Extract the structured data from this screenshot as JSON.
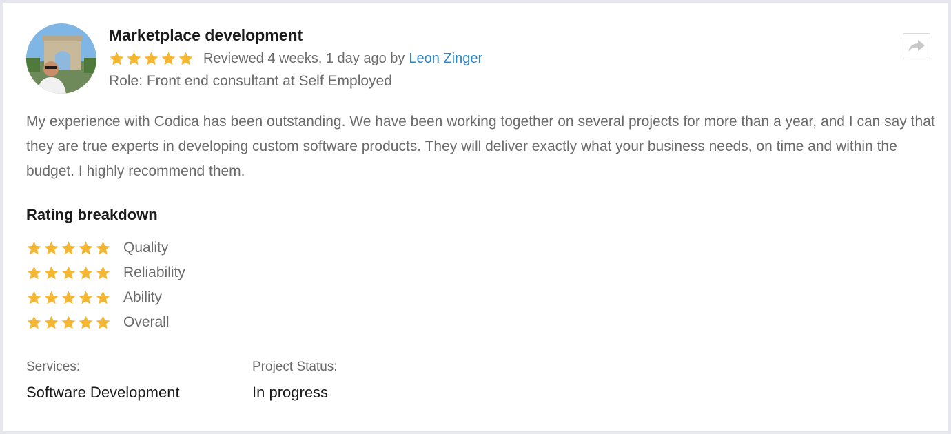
{
  "review": {
    "title": "Marketplace development",
    "rating_stars": 5,
    "reviewed_text": "Reviewed 4 weeks, 1 day ago by",
    "reviewer_name": "Leon Zinger",
    "role": "Role: Front end consultant at Self Employed",
    "body": "My experience with Codica has been outstanding. We have been working together on several projects for more than a year, and I can say that they are true experts in developing custom software products. They will deliver exactly what your business needs, on time and within the budget. I highly recommend them."
  },
  "breakdown": {
    "title": "Rating breakdown",
    "items": [
      {
        "label": "Quality",
        "stars": 5
      },
      {
        "label": "Reliability",
        "stars": 5
      },
      {
        "label": "Ability",
        "stars": 5
      },
      {
        "label": "Overall",
        "stars": 5
      }
    ]
  },
  "details": {
    "services_label": "Services:",
    "services_value": "Software Development",
    "status_label": "Project Status:",
    "status_value": "In progress"
  },
  "icons": {
    "share": "share-arrow-icon",
    "star": "star-icon",
    "avatar": "avatar-photo"
  },
  "colors": {
    "star": "#f5b731",
    "link": "#2e86c8",
    "text_muted": "#6b6b6b",
    "text_dark": "#1b1b1b"
  }
}
